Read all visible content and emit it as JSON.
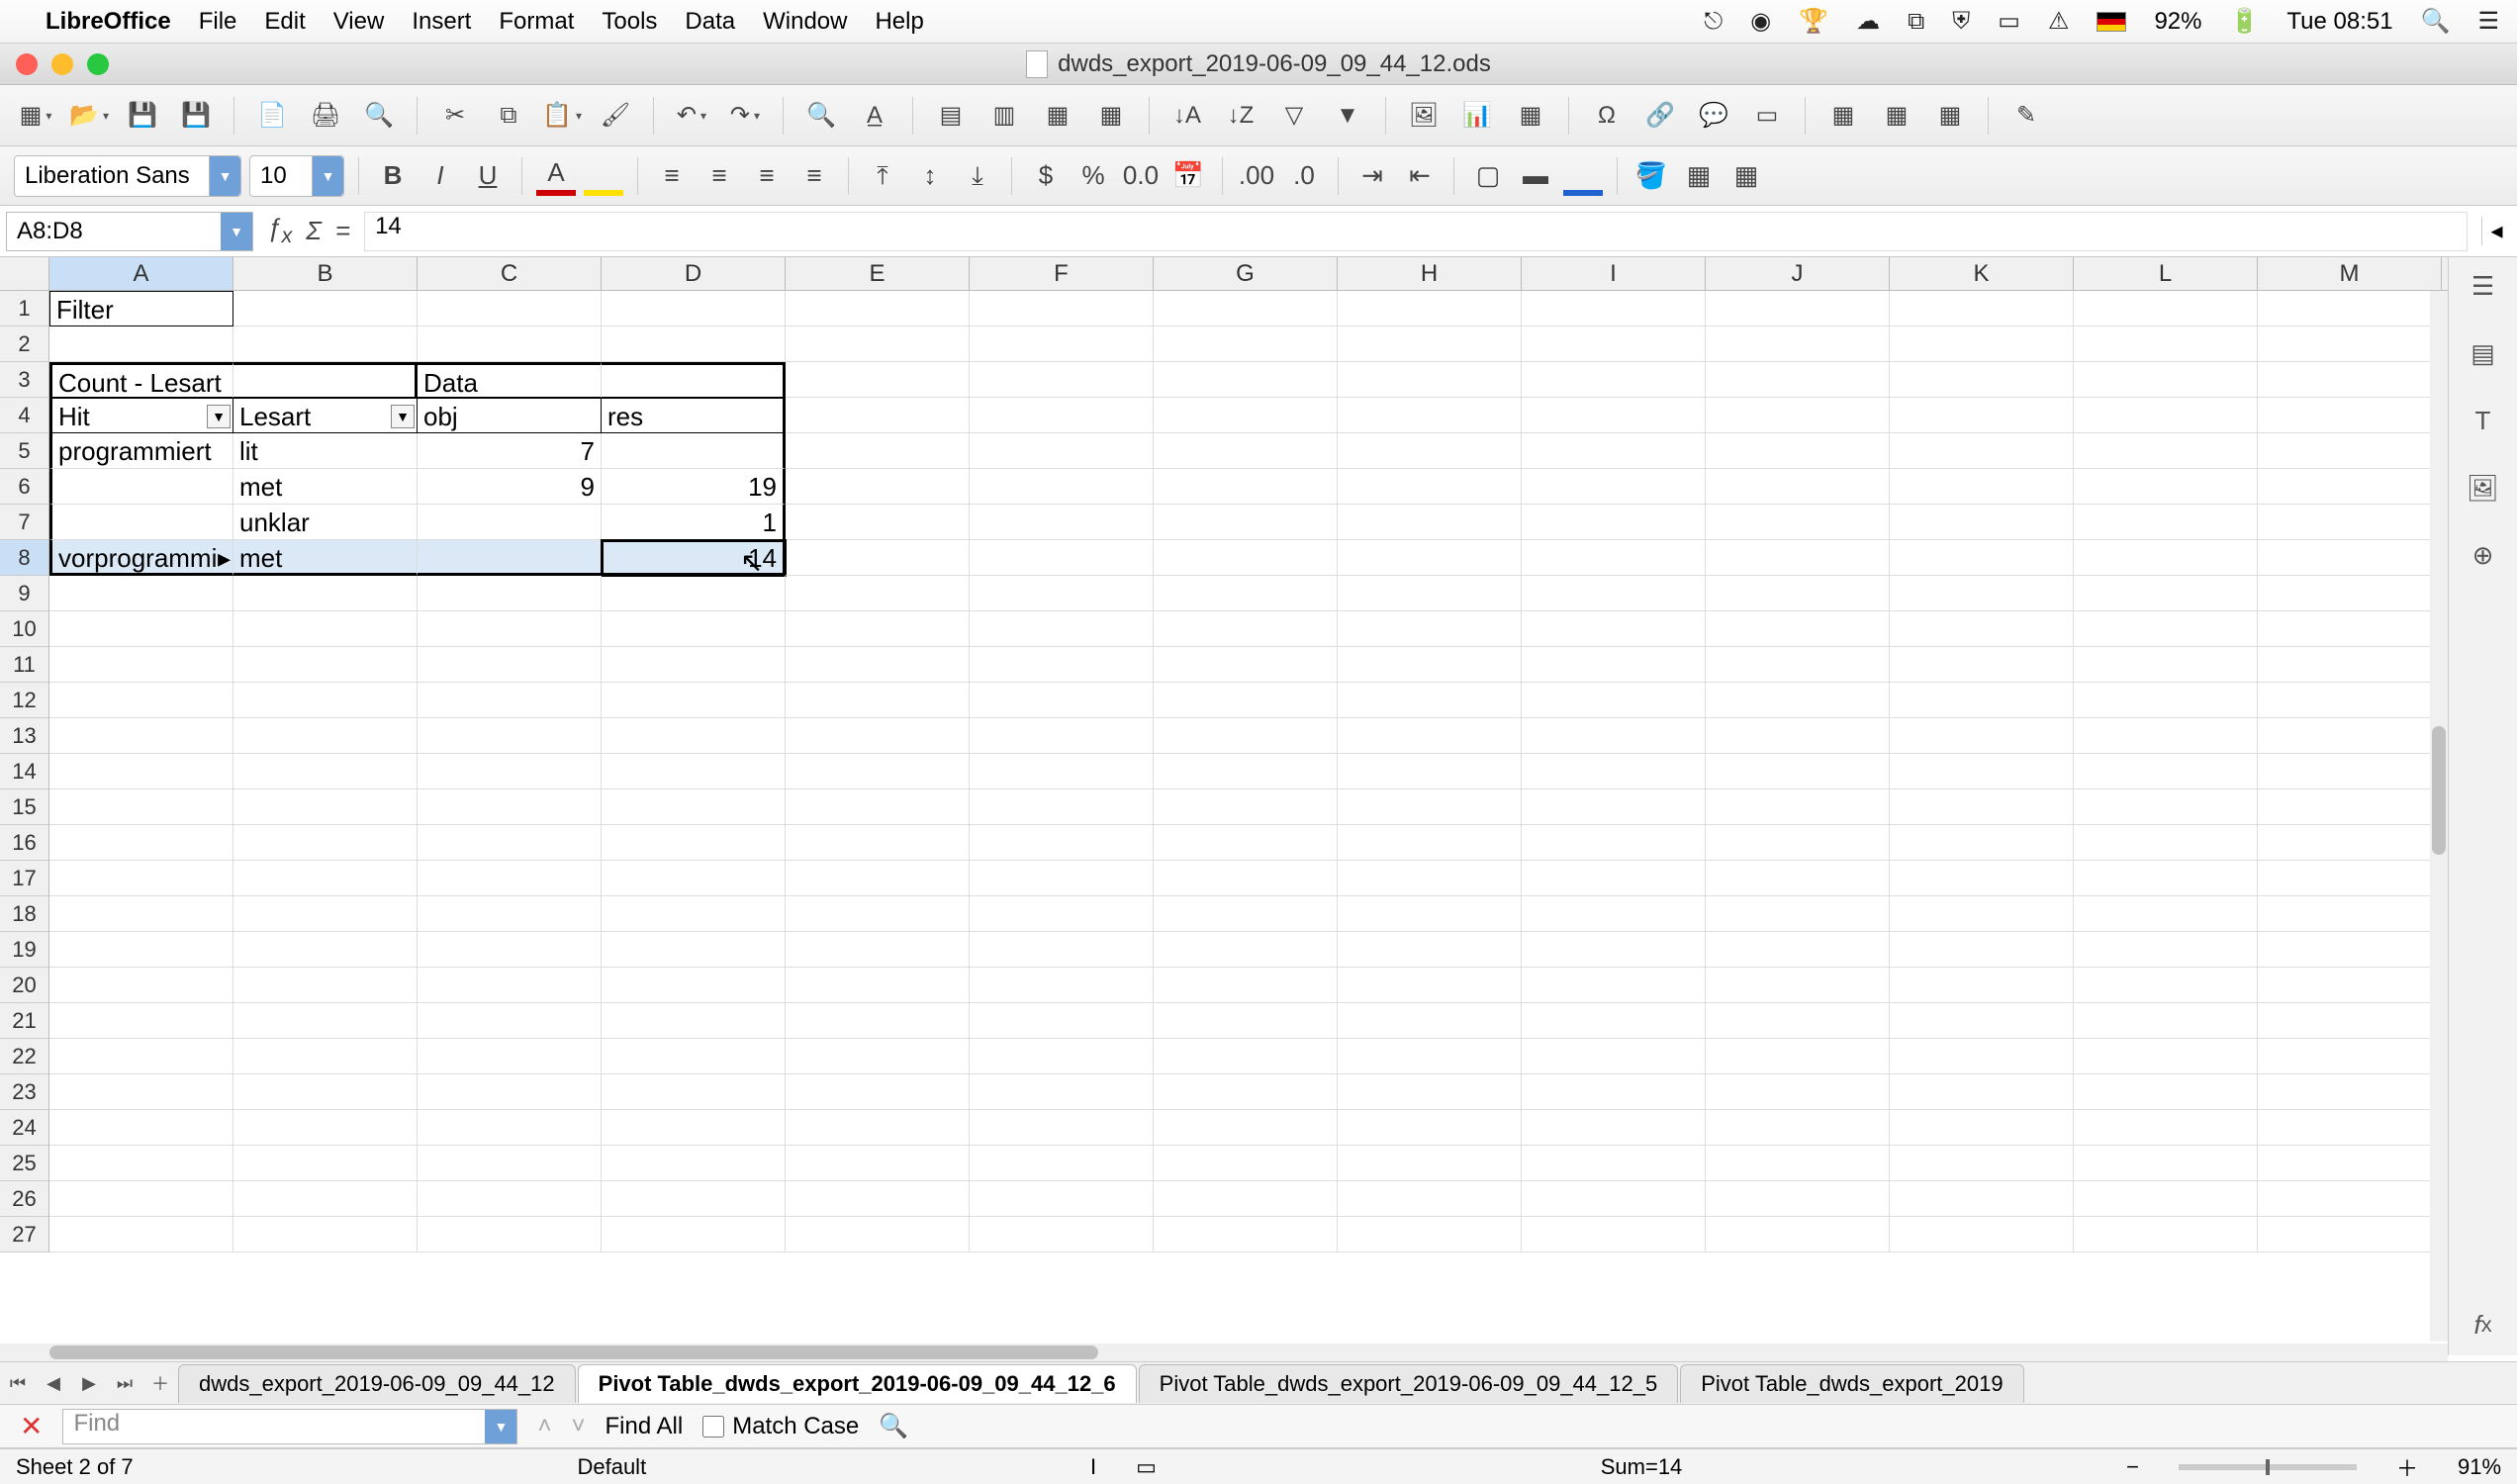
{
  "os": {
    "app_name": "LibreOffice",
    "menus": [
      "File",
      "Edit",
      "View",
      "Insert",
      "Format",
      "Tools",
      "Data",
      "Window",
      "Help"
    ],
    "battery": "92%",
    "clock": "Tue 08:51"
  },
  "window": {
    "title": "dwds_export_2019-06-09_09_44_12.ods"
  },
  "formatbar": {
    "font_name": "Liberation Sans",
    "font_size": "10"
  },
  "formula": {
    "name_box": "A8:D8",
    "value": "14"
  },
  "columns": [
    "A",
    "B",
    "C",
    "D",
    "E",
    "F",
    "G",
    "H",
    "I",
    "J",
    "K",
    "L",
    "M"
  ],
  "cells": {
    "A1": "Filter",
    "A3": "Count - Lesart",
    "C3": "Data",
    "A4": "Hit",
    "B4": "Lesart",
    "C4": "obj",
    "D4": "res",
    "A5": "programmiert",
    "B5": "lit",
    "C5": "7",
    "B6": "met",
    "C6": "9",
    "D6": "19",
    "B7": "unklar",
    "D7": "1",
    "A8": "vorprogrammi",
    "B8": "met",
    "D8": "14"
  },
  "sheet_tabs": {
    "t1": "dwds_export_2019-06-09_09_44_12",
    "t2": "Pivot Table_dwds_export_2019-06-09_09_44_12_6",
    "t3": "Pivot Table_dwds_export_2019-06-09_09_44_12_5",
    "t4": "Pivot Table_dwds_export_2019"
  },
  "findbar": {
    "placeholder": "Find",
    "find_all": "Find All",
    "match_case": "Match Case"
  },
  "statusbar": {
    "sheet_info": "Sheet 2 of 7",
    "style": "Default",
    "sum": "Sum=14",
    "zoom": "91%"
  }
}
